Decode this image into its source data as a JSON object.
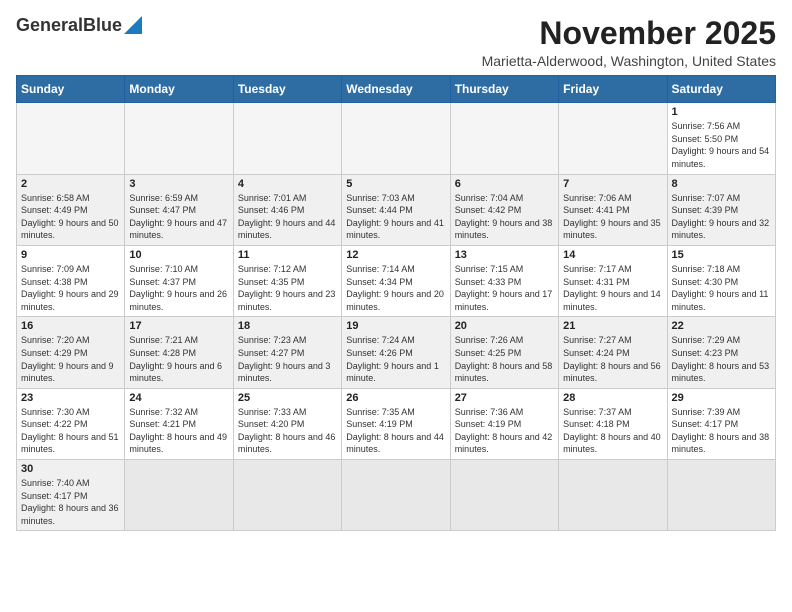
{
  "header": {
    "logo_general": "General",
    "logo_blue": "Blue",
    "main_title": "November 2025",
    "subtitle": "Marietta-Alderwood, Washington, United States"
  },
  "calendar": {
    "days_of_week": [
      "Sunday",
      "Monday",
      "Tuesday",
      "Wednesday",
      "Thursday",
      "Friday",
      "Saturday"
    ],
    "weeks": [
      [
        {
          "day": "",
          "info": ""
        },
        {
          "day": "",
          "info": ""
        },
        {
          "day": "",
          "info": ""
        },
        {
          "day": "",
          "info": ""
        },
        {
          "day": "",
          "info": ""
        },
        {
          "day": "",
          "info": ""
        },
        {
          "day": "1",
          "info": "Sunrise: 7:56 AM\nSunset: 5:50 PM\nDaylight: 9 hours and 54 minutes."
        }
      ],
      [
        {
          "day": "2",
          "info": "Sunrise: 6:58 AM\nSunset: 4:49 PM\nDaylight: 9 hours and 50 minutes."
        },
        {
          "day": "3",
          "info": "Sunrise: 6:59 AM\nSunset: 4:47 PM\nDaylight: 9 hours and 47 minutes."
        },
        {
          "day": "4",
          "info": "Sunrise: 7:01 AM\nSunset: 4:46 PM\nDaylight: 9 hours and 44 minutes."
        },
        {
          "day": "5",
          "info": "Sunrise: 7:03 AM\nSunset: 4:44 PM\nDaylight: 9 hours and 41 minutes."
        },
        {
          "day": "6",
          "info": "Sunrise: 7:04 AM\nSunset: 4:42 PM\nDaylight: 9 hours and 38 minutes."
        },
        {
          "day": "7",
          "info": "Sunrise: 7:06 AM\nSunset: 4:41 PM\nDaylight: 9 hours and 35 minutes."
        },
        {
          "day": "8",
          "info": "Sunrise: 7:07 AM\nSunset: 4:39 PM\nDaylight: 9 hours and 32 minutes."
        }
      ],
      [
        {
          "day": "9",
          "info": "Sunrise: 7:09 AM\nSunset: 4:38 PM\nDaylight: 9 hours and 29 minutes."
        },
        {
          "day": "10",
          "info": "Sunrise: 7:10 AM\nSunset: 4:37 PM\nDaylight: 9 hours and 26 minutes."
        },
        {
          "day": "11",
          "info": "Sunrise: 7:12 AM\nSunset: 4:35 PM\nDaylight: 9 hours and 23 minutes."
        },
        {
          "day": "12",
          "info": "Sunrise: 7:14 AM\nSunset: 4:34 PM\nDaylight: 9 hours and 20 minutes."
        },
        {
          "day": "13",
          "info": "Sunrise: 7:15 AM\nSunset: 4:33 PM\nDaylight: 9 hours and 17 minutes."
        },
        {
          "day": "14",
          "info": "Sunrise: 7:17 AM\nSunset: 4:31 PM\nDaylight: 9 hours and 14 minutes."
        },
        {
          "day": "15",
          "info": "Sunrise: 7:18 AM\nSunset: 4:30 PM\nDaylight: 9 hours and 11 minutes."
        }
      ],
      [
        {
          "day": "16",
          "info": "Sunrise: 7:20 AM\nSunset: 4:29 PM\nDaylight: 9 hours and 9 minutes."
        },
        {
          "day": "17",
          "info": "Sunrise: 7:21 AM\nSunset: 4:28 PM\nDaylight: 9 hours and 6 minutes."
        },
        {
          "day": "18",
          "info": "Sunrise: 7:23 AM\nSunset: 4:27 PM\nDaylight: 9 hours and 3 minutes."
        },
        {
          "day": "19",
          "info": "Sunrise: 7:24 AM\nSunset: 4:26 PM\nDaylight: 9 hours and 1 minute."
        },
        {
          "day": "20",
          "info": "Sunrise: 7:26 AM\nSunset: 4:25 PM\nDaylight: 8 hours and 58 minutes."
        },
        {
          "day": "21",
          "info": "Sunrise: 7:27 AM\nSunset: 4:24 PM\nDaylight: 8 hours and 56 minutes."
        },
        {
          "day": "22",
          "info": "Sunrise: 7:29 AM\nSunset: 4:23 PM\nDaylight: 8 hours and 53 minutes."
        }
      ],
      [
        {
          "day": "23",
          "info": "Sunrise: 7:30 AM\nSunset: 4:22 PM\nDaylight: 8 hours and 51 minutes."
        },
        {
          "day": "24",
          "info": "Sunrise: 7:32 AM\nSunset: 4:21 PM\nDaylight: 8 hours and 49 minutes."
        },
        {
          "day": "25",
          "info": "Sunrise: 7:33 AM\nSunset: 4:20 PM\nDaylight: 8 hours and 46 minutes."
        },
        {
          "day": "26",
          "info": "Sunrise: 7:35 AM\nSunset: 4:19 PM\nDaylight: 8 hours and 44 minutes."
        },
        {
          "day": "27",
          "info": "Sunrise: 7:36 AM\nSunset: 4:19 PM\nDaylight: 8 hours and 42 minutes."
        },
        {
          "day": "28",
          "info": "Sunrise: 7:37 AM\nSunset: 4:18 PM\nDaylight: 8 hours and 40 minutes."
        },
        {
          "day": "29",
          "info": "Sunrise: 7:39 AM\nSunset: 4:17 PM\nDaylight: 8 hours and 38 minutes."
        }
      ],
      [
        {
          "day": "30",
          "info": "Sunrise: 7:40 AM\nSunset: 4:17 PM\nDaylight: 8 hours and 36 minutes."
        },
        {
          "day": "",
          "info": ""
        },
        {
          "day": "",
          "info": ""
        },
        {
          "day": "",
          "info": ""
        },
        {
          "day": "",
          "info": ""
        },
        {
          "day": "",
          "info": ""
        },
        {
          "day": "",
          "info": ""
        }
      ]
    ]
  }
}
